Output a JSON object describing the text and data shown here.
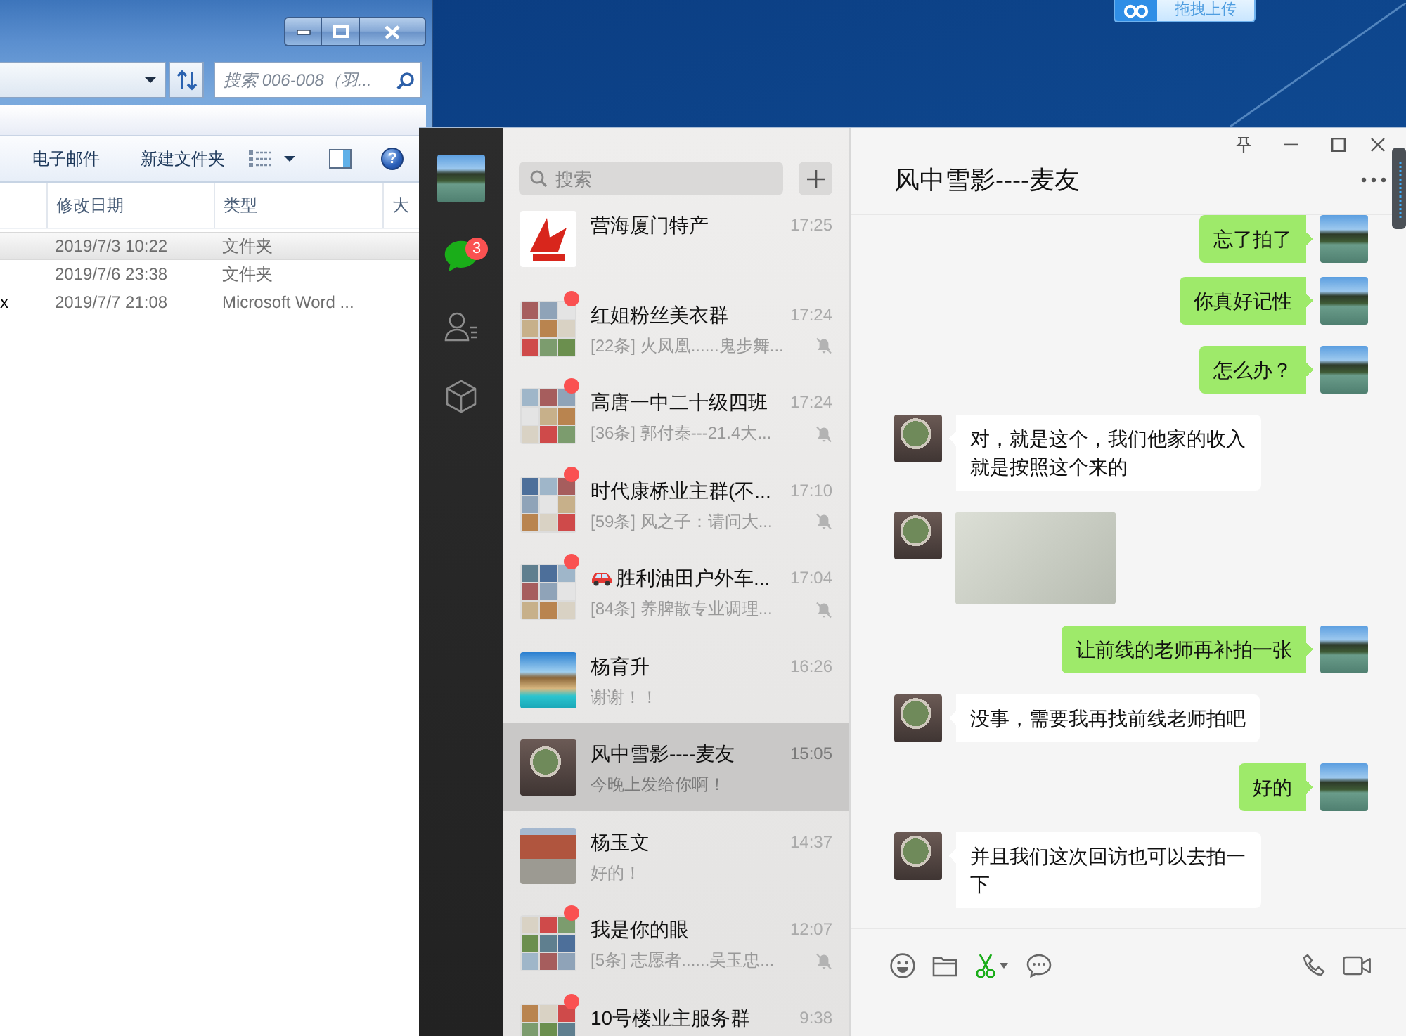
{
  "desktop": {
    "upload_widget": {
      "label": "拖拽上传"
    }
  },
  "explorer": {
    "search": {
      "placeholder": "搜索 006-008（羽..."
    },
    "toolbar": [
      {
        "kind": "text",
        "label": "电子邮件"
      },
      {
        "kind": "text",
        "label": "新建文件夹"
      },
      {
        "kind": "views"
      },
      {
        "kind": "pane"
      },
      {
        "kind": "help",
        "label": "?"
      }
    ],
    "columns": [
      "修改日期",
      "类型",
      "大"
    ],
    "rows": [
      {
        "modified": "2019/7/3 10:22",
        "type": "文件夹",
        "selected": true
      },
      {
        "modified": "2019/7/6 23:38",
        "type": "文件夹",
        "selected": false
      },
      {
        "name": "x",
        "modified": "2019/7/7 21:08",
        "type": "Microsoft Word ...",
        "selected": false
      }
    ]
  },
  "wechat": {
    "sidebar": [
      {
        "kind": "chats",
        "selected": true,
        "badge": "3"
      },
      {
        "kind": "contacts",
        "selected": false
      },
      {
        "kind": "favorites",
        "selected": false
      }
    ],
    "search": {
      "placeholder": "搜索"
    },
    "chats": [
      {
        "name": "营海厦门特产",
        "time": "17:25",
        "avatar": {
          "kind": "logo"
        },
        "name_icon": false,
        "unread": false,
        "muted": false,
        "selected": false
      },
      {
        "name": "红姐粉丝美衣群",
        "time": "17:24",
        "preview": "[22条] 火凤凰......鬼步舞...",
        "avatar": {
          "kind": "group"
        },
        "name_icon": false,
        "unread": true,
        "muted": true,
        "selected": false
      },
      {
        "name": "高唐一中二十级四班",
        "time": "17:24",
        "preview": "[36条] 郭付秦---21.4大...",
        "avatar": {
          "kind": "group"
        },
        "name_icon": false,
        "unread": true,
        "muted": true,
        "selected": false
      },
      {
        "name": "时代康桥业主群(不...",
        "time": "17:10",
        "preview": "[59条] 风之子：请问大...",
        "avatar": {
          "kind": "group"
        },
        "name_icon": false,
        "unread": true,
        "muted": true,
        "selected": false
      },
      {
        "name": "胜利油田户外车...",
        "time": "17:04",
        "preview": "[84条] 养脾散专业调理...",
        "avatar": {
          "kind": "group"
        },
        "name_icon": true,
        "unread": true,
        "muted": true,
        "selected": false
      },
      {
        "name": "杨育升",
        "time": "16:26",
        "preview": "谢谢！！",
        "avatar": {
          "kind": "beach"
        },
        "name_icon": false,
        "unread": false,
        "muted": false,
        "selected": false
      },
      {
        "name": "风中雪影----麦友",
        "time": "15:05",
        "preview": "今晚上发给你啊！",
        "avatar": {
          "kind": "circle"
        },
        "name_icon": false,
        "unread": false,
        "muted": false,
        "selected": true
      },
      {
        "name": "杨玉文",
        "time": "14:37",
        "preview": "好的！",
        "avatar": {
          "kind": "street"
        },
        "name_icon": false,
        "unread": false,
        "muted": false,
        "selected": false
      },
      {
        "name": "我是你的眼",
        "time": "12:07",
        "preview": "[5条] 志愿者......吴玉忠...",
        "avatar": {
          "kind": "group"
        },
        "name_icon": false,
        "unread": true,
        "muted": true,
        "selected": false
      },
      {
        "name": "10号楼业主服务群",
        "time": "9:38",
        "avatar": {
          "kind": "group"
        },
        "name_icon": false,
        "unread": true,
        "muted": false,
        "selected": false
      }
    ],
    "conversation": {
      "title": "风中雪影----麦友",
      "messages": [
        {
          "kind": "text",
          "outgoing": true,
          "text": "忘了拍了"
        },
        {
          "kind": "text",
          "outgoing": true,
          "text": "你真好记性"
        },
        {
          "kind": "text",
          "outgoing": true,
          "text": "怎么办？"
        },
        {
          "kind": "text",
          "outgoing": false,
          "text": "对，就是这个，我们他家的收入就是按照这个来的"
        },
        {
          "kind": "image",
          "outgoing": false
        },
        {
          "kind": "text",
          "outgoing": true,
          "text": "让前线的老师再补拍一张"
        },
        {
          "kind": "text",
          "outgoing": false,
          "text": "没事，需要我再找前线老师拍吧"
        },
        {
          "kind": "text",
          "outgoing": true,
          "text": "好的"
        },
        {
          "kind": "text",
          "outgoing": false,
          "text": "并且我们这次回访也可以去拍一下"
        }
      ]
    }
  }
}
